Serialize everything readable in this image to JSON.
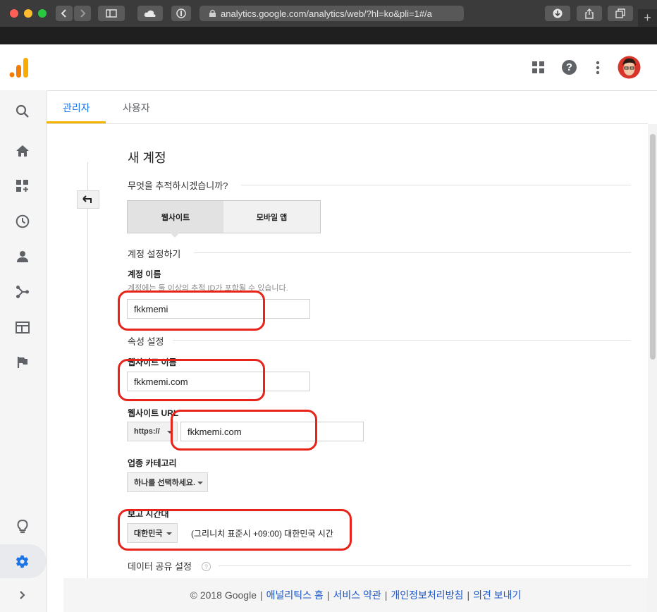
{
  "browser": {
    "url": "analytics.google.com/analytics/web/?hl=ko&pli=1#/a",
    "traffic_lights": [
      "#fe5f57",
      "#febc2e",
      "#28c840"
    ],
    "new_tab_symbol": "+"
  },
  "header": {
    "icons": [
      "apps-grid-icon",
      "help-icon",
      "more-vert-icon",
      "avatar"
    ]
  },
  "sidebar": {
    "items": [
      "search-icon",
      "home-icon",
      "customization-icon",
      "realtime-icon",
      "audience-icon",
      "acquisition-icon",
      "behavior-icon",
      "conversions-icon",
      "discover-icon",
      "admin-gear-icon",
      "expand-icon"
    ]
  },
  "tabs": [
    {
      "label": "관리자",
      "active": true
    },
    {
      "label": "사용자",
      "active": false
    }
  ],
  "form": {
    "title": "새 계정",
    "track_question": "무엇을 추적하시겠습니까?",
    "track_options": [
      {
        "label": "웹사이트",
        "selected": true
      },
      {
        "label": "모바일 앱",
        "selected": false
      }
    ],
    "account_section": "계정 설정하기",
    "account_name_label": "계정 이름",
    "account_name_help": "계정에는 둘 이상의 추적 ID가 포함될 수 있습니다.",
    "account_name_value": "fkkmemi",
    "property_section": "속성 설정",
    "website_name_label": "웹사이트 이름",
    "website_name_value": "fkkmemi.com",
    "website_url_label": "웹사이트 URL",
    "protocol_value": "https://",
    "website_url_value": "fkkmemi.com",
    "industry_label": "업종 카테고리",
    "industry_value": "하나를 선택하세요.",
    "timezone_label": "보고 시간대",
    "timezone_country": "대한민국",
    "timezone_value": "(그리니치 표준시 +09:00) 대한민국 시간",
    "data_sharing_label": "데이터 공유 설정",
    "help_symbol": "?"
  },
  "footer": {
    "copyright": "© 2018 Google",
    "links": [
      "애널리틱스 홈",
      "서비스 약관",
      "개인정보처리방침",
      "의견 보내기"
    ],
    "separator": "|"
  },
  "colors": {
    "accent": "#f4b400",
    "logo_orange": "#f57c00",
    "admin_blue": "#1a73e8",
    "annotation_red": "#e8231a"
  }
}
